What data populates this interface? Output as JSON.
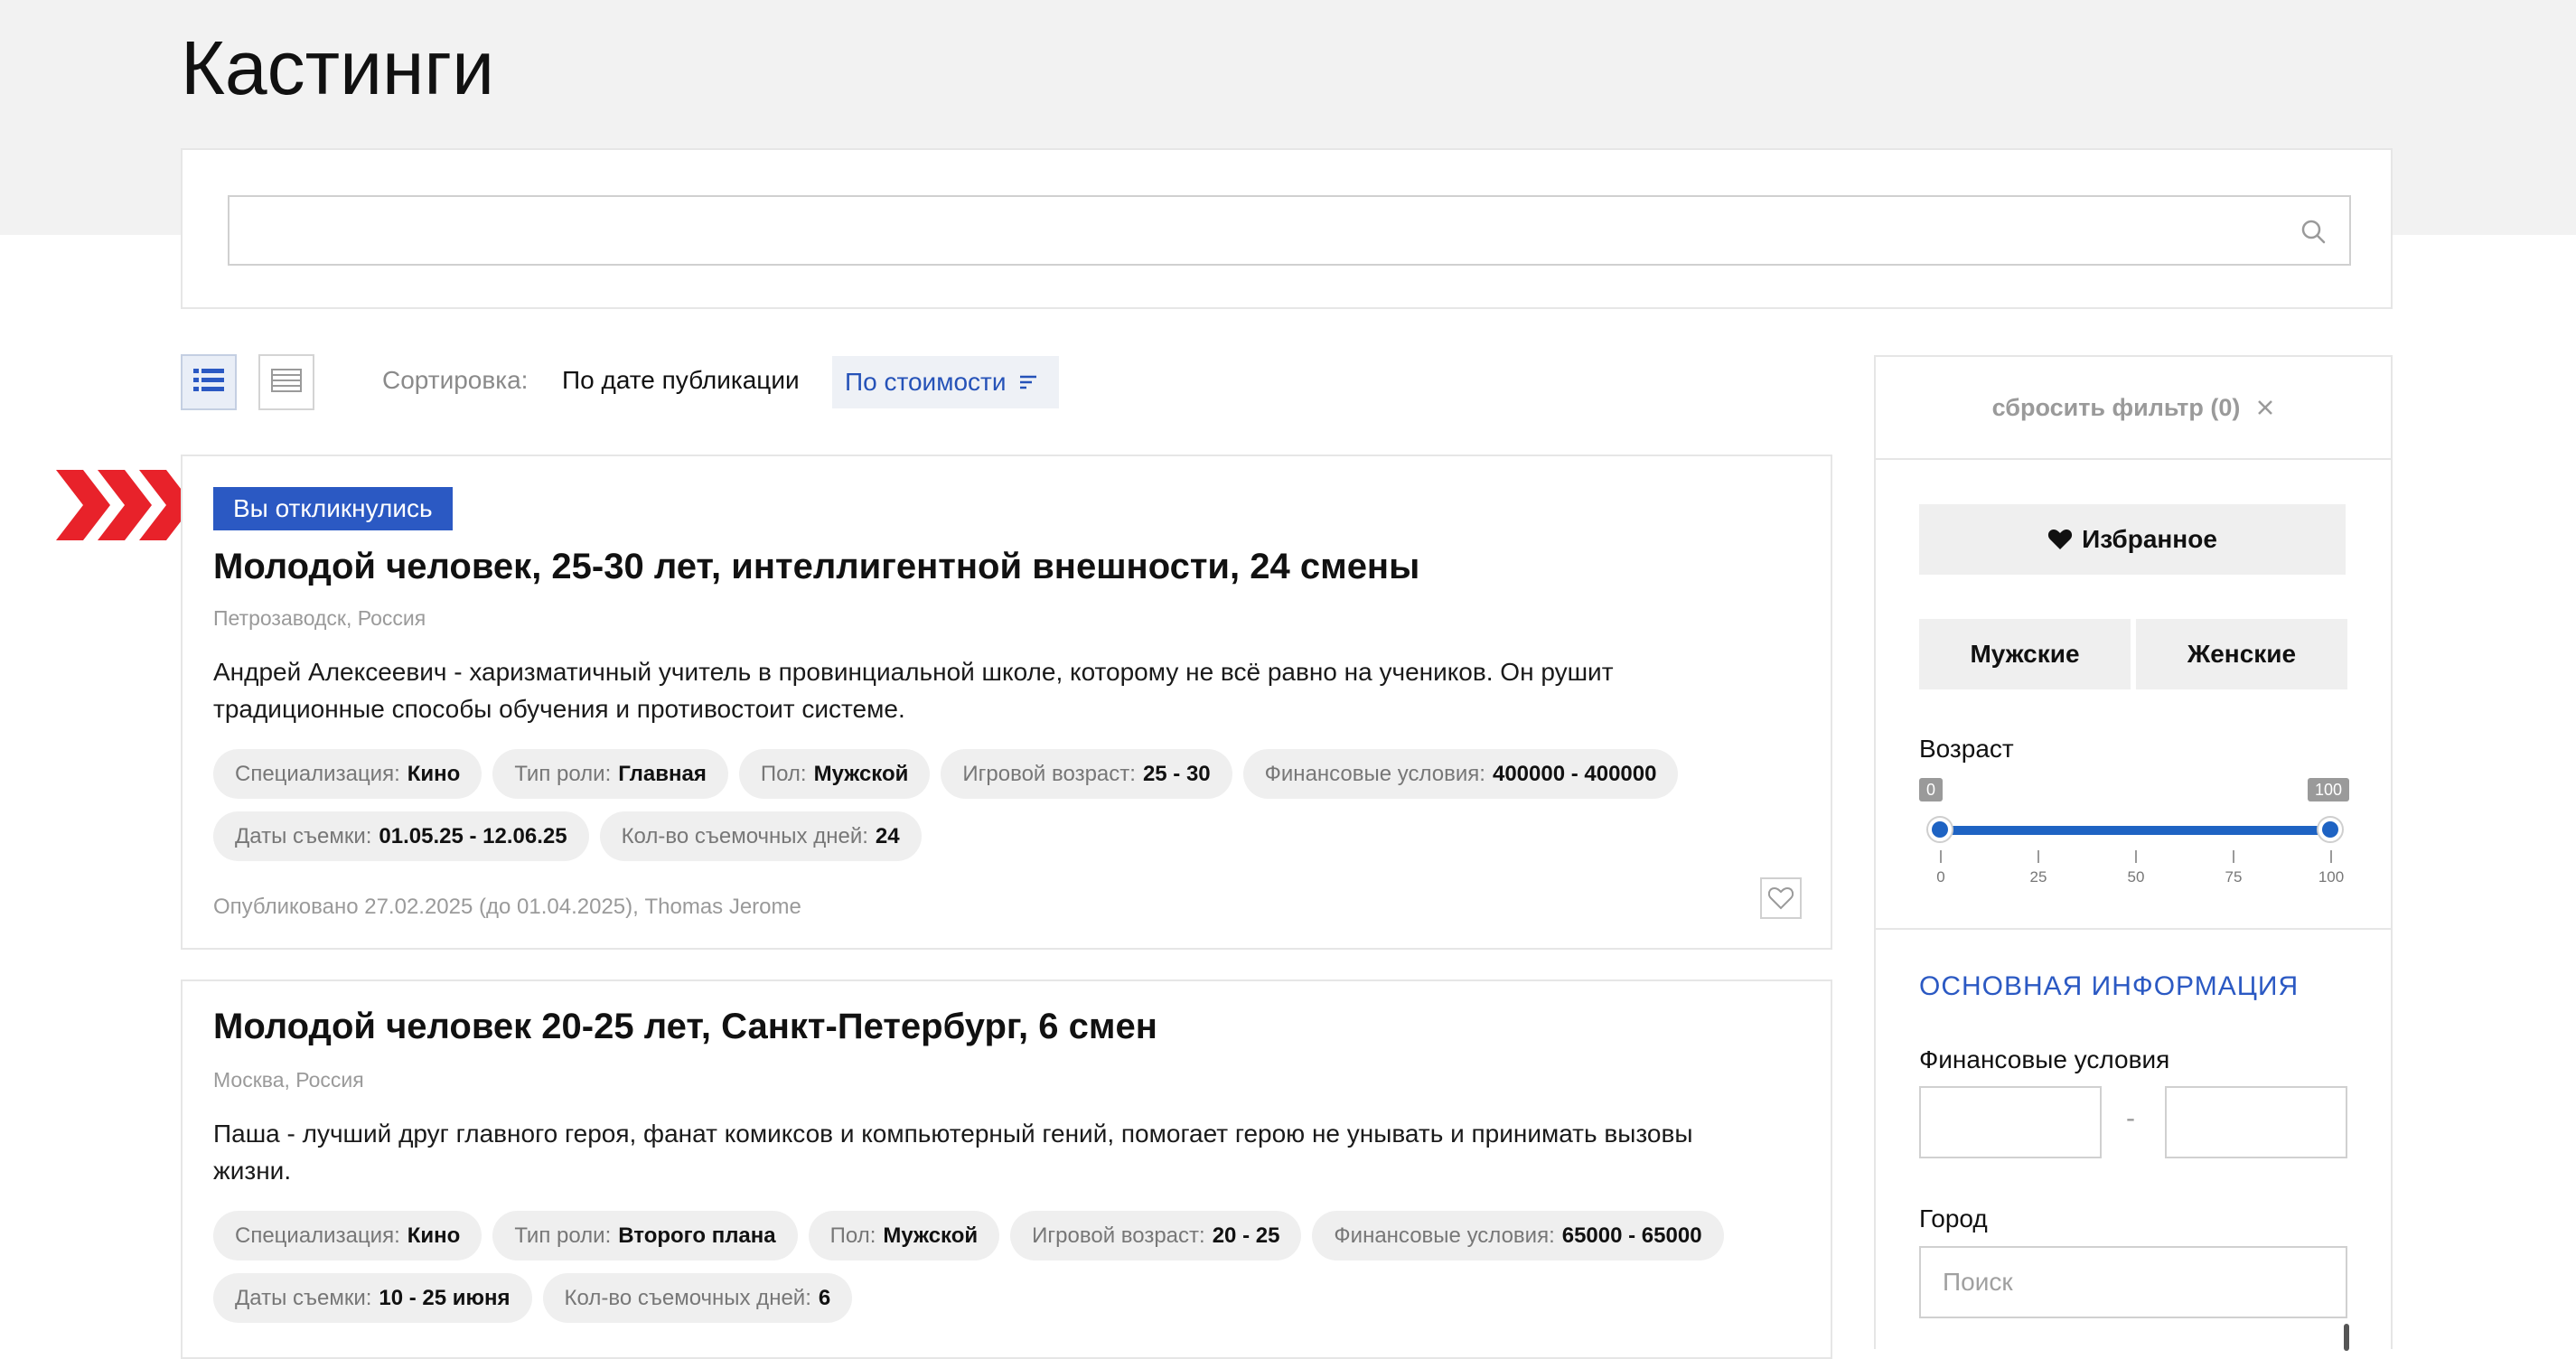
{
  "page": {
    "title": "Кастинги"
  },
  "search": {
    "value": "",
    "placeholder": ""
  },
  "sorting": {
    "label": "Сортировка:",
    "options": [
      "По дате публикации",
      "По стоимости"
    ],
    "active": "По стоимости"
  },
  "listings": [
    {
      "badge": "Вы откликнулись",
      "title": "Молодой человек, 25-30 лет, интеллигентной внешности, 24 смены",
      "location": "Петрозаводск, Россия",
      "description": "Андрей Алексеевич - харизматичный учитель в провинциальной школе, которому не всё равно на учеников. Он рушит традиционные способы обучения и противостоит системе.",
      "tags": [
        {
          "key": "Специализация:",
          "value": "Кино"
        },
        {
          "key": "Тип роли:",
          "value": "Главная"
        },
        {
          "key": "Пол:",
          "value": "Мужской"
        },
        {
          "key": "Игровой возраст:",
          "value": "25 - 30"
        },
        {
          "key": "Финансовые условия:",
          "value": "400000 - 400000"
        },
        {
          "key": "Даты съемки:",
          "value": "01.05.25 - 12.06.25"
        },
        {
          "key": "Кол-во съемочных дней:",
          "value": "24"
        }
      ],
      "footer": "Опубликовано 27.02.2025 (до 01.04.2025), Thomas Jerome"
    },
    {
      "title": "Молодой человек 20-25 лет, Санкт-Петербург, 6 смен",
      "location": "Москва, Россия",
      "description": "Паша - лучший друг главного героя, фанат комиксов и компьютерный гений, помогает герою не унывать и принимать вызовы жизни.",
      "tags": [
        {
          "key": "Специализация:",
          "value": "Кино"
        },
        {
          "key": "Тип роли:",
          "value": "Второго плана"
        },
        {
          "key": "Пол:",
          "value": "Мужской"
        },
        {
          "key": "Игровой возраст:",
          "value": "20 - 25"
        },
        {
          "key": "Финансовые условия:",
          "value": "65000 - 65000"
        },
        {
          "key": "Даты съемки:",
          "value": "10 - 25 июня"
        },
        {
          "key": "Кол-во съемочных дней:",
          "value": "6"
        }
      ]
    }
  ],
  "sidebar": {
    "reset_label": "сбросить фильтр (0)",
    "favorites_label": "Избранное",
    "gender_options": [
      "Мужские",
      "Женские"
    ],
    "age": {
      "label": "Возраст",
      "min_value": "0",
      "max_value": "100",
      "ticks": [
        "0",
        "25",
        "50",
        "75",
        "100"
      ]
    },
    "section_title": "ОСНОВНАЯ ИНФОРМАЦИЯ",
    "finance_label": "Финансовые условия",
    "finance_separator": "-",
    "city_label": "Город",
    "city_placeholder": "Поиск"
  },
  "colors": {
    "accent": "#2b59c3",
    "slider": "#1e63c3",
    "arrow": "#e8222a",
    "tag_bg": "#efefef",
    "header_bg": "#f2f2f2"
  },
  "icons": [
    "search-icon",
    "list-view-icon",
    "table-view-icon",
    "sort-icon",
    "heart-outline-icon",
    "heart-icon",
    "close-icon",
    "chevron-arrows-icon"
  ]
}
